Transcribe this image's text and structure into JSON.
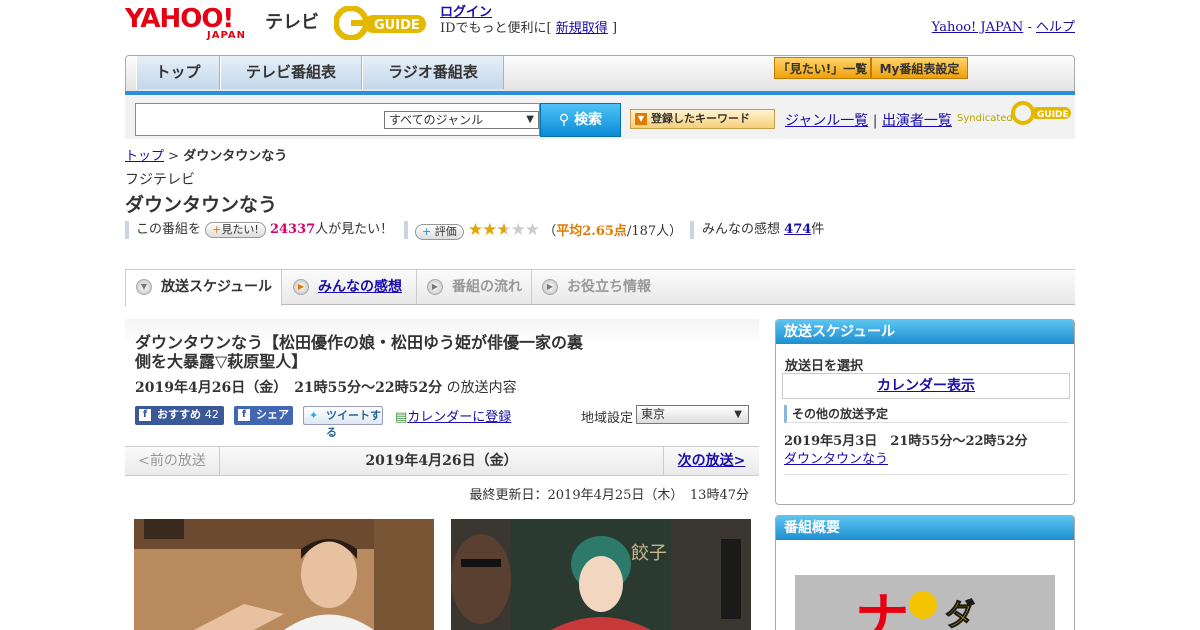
{
  "header": {
    "logo_text": "YAHOO!",
    "logo_japan": "JAPAN",
    "logo_tv": "テレビ",
    "gguide_text": "G-GUIDE",
    "login_label": "ログイン",
    "login_note_prefix": "IDでもっと便利に[",
    "signup_label": "新規取得",
    "login_note_suffix": "]",
    "yahoo_japan_link": "Yahoo! JAPAN",
    "link_sep": "-",
    "help_link": "ヘルプ"
  },
  "nav": {
    "tabs": [
      "トップ",
      "テレビ番組表",
      "ラジオ番組表"
    ],
    "want_list_btn": "「見たい!」一覧",
    "my_schedule_btn": "My番組表設定"
  },
  "search": {
    "placeholder": "",
    "genre_selected": "すべてのジャンル",
    "search_button": "検索",
    "keyword_button": "登録したキーワード",
    "genre_list_link": "ジャンル一覧",
    "sep": "|",
    "performer_list_link": "出演者一覧",
    "syndicated": "Syndicated"
  },
  "breadcrumb": {
    "top": "トップ",
    "sep": ">",
    "current": "ダウンタウンなう"
  },
  "program": {
    "station": "フジテレビ",
    "title": "ダウンタウンなう",
    "want_prefix": "この番組を",
    "want_button": "見たい!",
    "want_count": "24337",
    "want_suffix": "人が見たい！",
    "rate_button": "評価",
    "rating_open": "（",
    "rating_avg": "平均2.65点",
    "rating_count": "/187人）",
    "rating_value": 2.65,
    "reviews_label": "みんなの感想",
    "reviews_count": "474",
    "reviews_suffix": "件"
  },
  "subtabs": [
    "放送スケジュール",
    "みんなの感想",
    "番組の流れ",
    "お役立ち情報"
  ],
  "episode": {
    "title": "ダウンタウンなう【松田優作の娘・松田ゆう姫が俳優一家の裏側を大暴露▽萩原聖人】",
    "date_time": "2019年4月26日（金）　21時55分～22時52分",
    "content_suffix": "の放送内容",
    "fb_recommend": "おすすめ",
    "fb_count": "42",
    "fb_share": "シェア",
    "tweet": "ツイートする",
    "calendar_register": "カレンダーに登録",
    "region_label": "地域設定",
    "region_selected": "東京"
  },
  "pager": {
    "prev": "<前の放送",
    "date": "2019年4月26日（金）",
    "next": "次の放送>"
  },
  "updated": "最終更新日：2019年4月25日（木）　13時47分",
  "sidebar": {
    "schedule_title": "放送スケジュール",
    "select_date": "放送日を選択",
    "calendar_button": "カレンダー表示",
    "other_schedule": "その他の放送予定",
    "next_datetime": "2019年5月3日　21時55分～22時52分",
    "next_title": "ダウンタウンなう",
    "overview_title": "番組概要"
  },
  "colors": {
    "accent_blue": "#2a8fd8",
    "brand_red": "#e60012",
    "want_pink": "#d6006f",
    "rating_orange": "#e07a00"
  }
}
